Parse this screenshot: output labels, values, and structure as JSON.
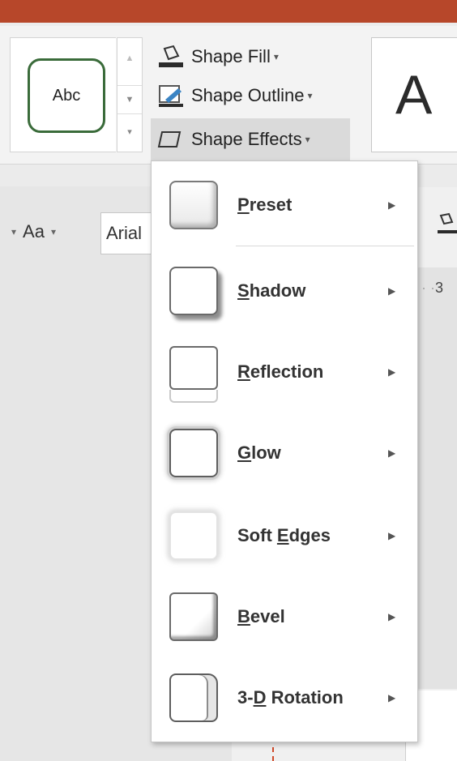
{
  "ribbon": {
    "shape_style_preview": "Abc",
    "shape_fill": "Shape Fill",
    "shape_outline": "Shape Outline",
    "shape_effects": "Shape Effects",
    "wordart_preview": "A"
  },
  "format_bar": {
    "aa_label": "Aa",
    "font_name": "Arial"
  },
  "ruler": {
    "marker": "3"
  },
  "menu": {
    "items": [
      {
        "prefix": "",
        "hotkey": "P",
        "rest": "reset",
        "icon": "preset-icon"
      },
      {
        "prefix": "",
        "hotkey": "S",
        "rest": "hadow",
        "icon": "shadow-icon"
      },
      {
        "prefix": "",
        "hotkey": "R",
        "rest": "eflection",
        "icon": "reflection-icon"
      },
      {
        "prefix": "",
        "hotkey": "G",
        "rest": "low",
        "icon": "glow-icon"
      },
      {
        "prefix": "Soft ",
        "hotkey": "E",
        "rest": "dges",
        "icon": "soft-edges-icon"
      },
      {
        "prefix": "",
        "hotkey": "B",
        "rest": "evel",
        "icon": "bevel-icon"
      },
      {
        "prefix": "3-",
        "hotkey": "D",
        "rest": " Rotation",
        "icon": "3d-rotation-icon"
      }
    ]
  },
  "colors": {
    "title_bar": "#b7472a",
    "style_outline": "#3a6b3a"
  }
}
